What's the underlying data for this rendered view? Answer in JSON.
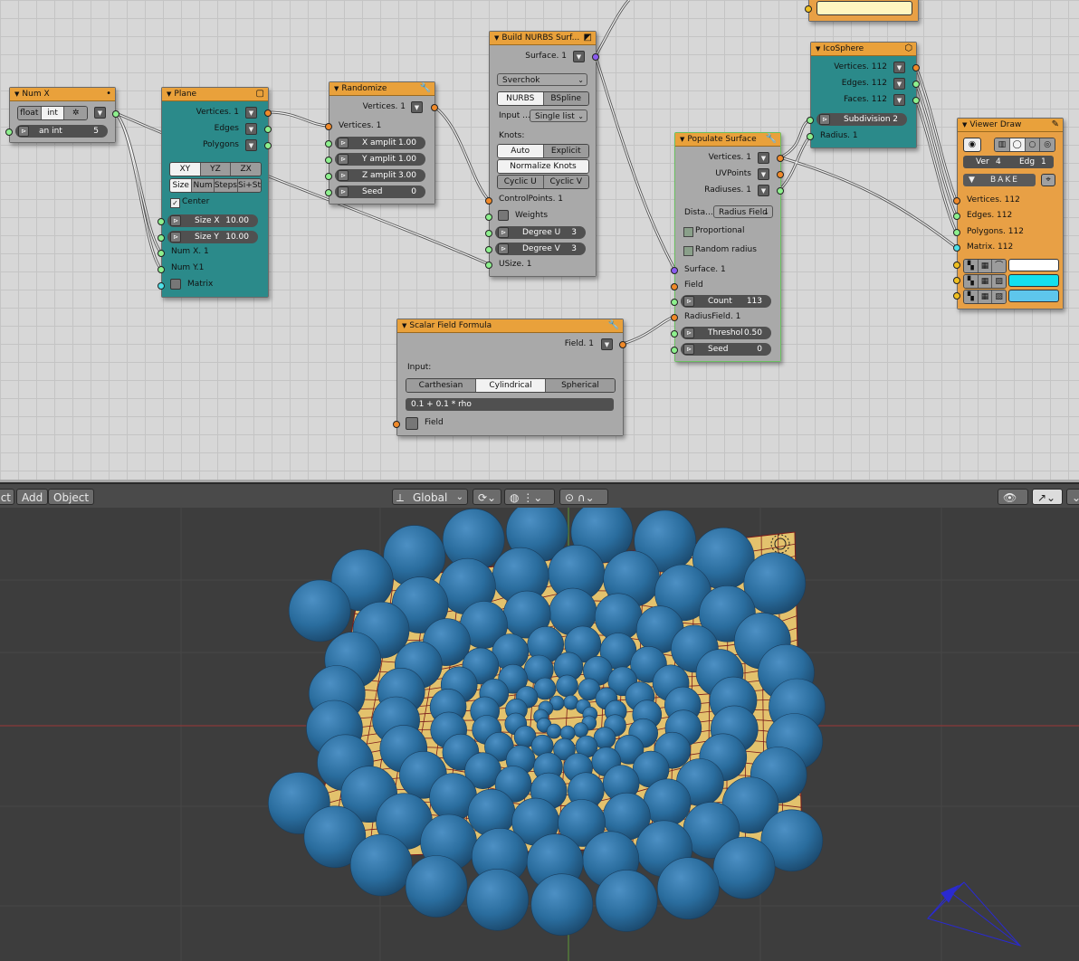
{
  "nodes": {
    "numx": {
      "title": "Num X",
      "mode_float": "float",
      "mode_int": "int",
      "field_label": "an int",
      "field_value": "5"
    },
    "plane": {
      "title": "Plane",
      "out": [
        "Vertices. 1",
        "Edges",
        "Polygons"
      ],
      "axes": [
        "XY",
        "YZ",
        "ZX"
      ],
      "modes": [
        "Size",
        "Num",
        "Steps",
        "Si+St"
      ],
      "center": "Center",
      "size_x_label": "Size X",
      "size_x_value": "10.00",
      "size_y_label": "Size Y",
      "size_y_value": "10.00",
      "in": [
        "Num X. 1",
        "Num Y.1",
        "Matrix"
      ]
    },
    "randomize": {
      "title": "Randomize",
      "out": "Vertices. 1",
      "in": "Vertices. 1",
      "fields": [
        {
          "label": "X amplit",
          "value": "1.00"
        },
        {
          "label": "Y amplit",
          "value": "1.00"
        },
        {
          "label": "Z amplit",
          "value": "3.00"
        },
        {
          "label": "Seed",
          "value": "0"
        }
      ]
    },
    "nurbs": {
      "title": "Build NURBS Surf...",
      "out": "Surface. 1",
      "implementation": "Sverchok",
      "types": [
        "NURBS",
        "BSpline"
      ],
      "input_label": "Input ...",
      "input_value": "Single list",
      "knots_label": "Knots:",
      "knot_modes": [
        "Auto",
        "Explicit"
      ],
      "normalize": "Normalize Knots",
      "cyclic": [
        "Cyclic U",
        "Cyclic V"
      ],
      "in": [
        "ControlPoints. 1",
        "Weights",
        "USize. 1"
      ],
      "degree_u_label": "Degree U",
      "degree_u_value": "3",
      "degree_v_label": "Degree V",
      "degree_v_value": "3"
    },
    "icosphere": {
      "title": "IcoSphere",
      "out": [
        "Vertices. 112",
        "Edges. 112",
        "Faces. 112"
      ],
      "subdiv_label": "Subdivision",
      "subdiv_value": "2",
      "in": "Radius. 1"
    },
    "populate": {
      "title": "Populate Surface",
      "out": [
        "Vertices. 1",
        "UVPoints",
        "Radiuses. 1"
      ],
      "dist_label": "Dista...",
      "dist_value": "Radius Field",
      "proportional": "Proportional",
      "random_radius": "Random radius",
      "in": [
        "Surface. 1",
        "Field",
        "RadiusField. 1"
      ],
      "count_label": "Count",
      "count_value": "113",
      "thresh_label": "Threshol",
      "thresh_value": "0.50",
      "seed_label": "Seed",
      "seed_value": "0"
    },
    "viewer": {
      "title": "Viewer Draw",
      "ver_label": "Ver",
      "ver_value": "4",
      "edg_label": "Edg",
      "edg_value": "1",
      "bake": "BAKE",
      "in": [
        "Vertices. 112",
        "Edges. 112",
        "Polygons. 112",
        "Matrix. 112"
      ]
    },
    "scalar": {
      "title": "Scalar Field Formula",
      "out": "Field. 1",
      "input_label": "Input:",
      "coords": [
        "Carthesian",
        "Cylindrical",
        "Spherical"
      ],
      "formula": "0.1 + 0.1 * rho",
      "in": "Field"
    }
  },
  "viewport_header": {
    "menu": [
      "ct",
      "Add",
      "Object"
    ],
    "orientation": "Global"
  },
  "colors": {
    "header": "#e9a13b",
    "teal": "#2b8a8a",
    "surface": "#e3c26d",
    "sphere": "#2a6d9e"
  }
}
